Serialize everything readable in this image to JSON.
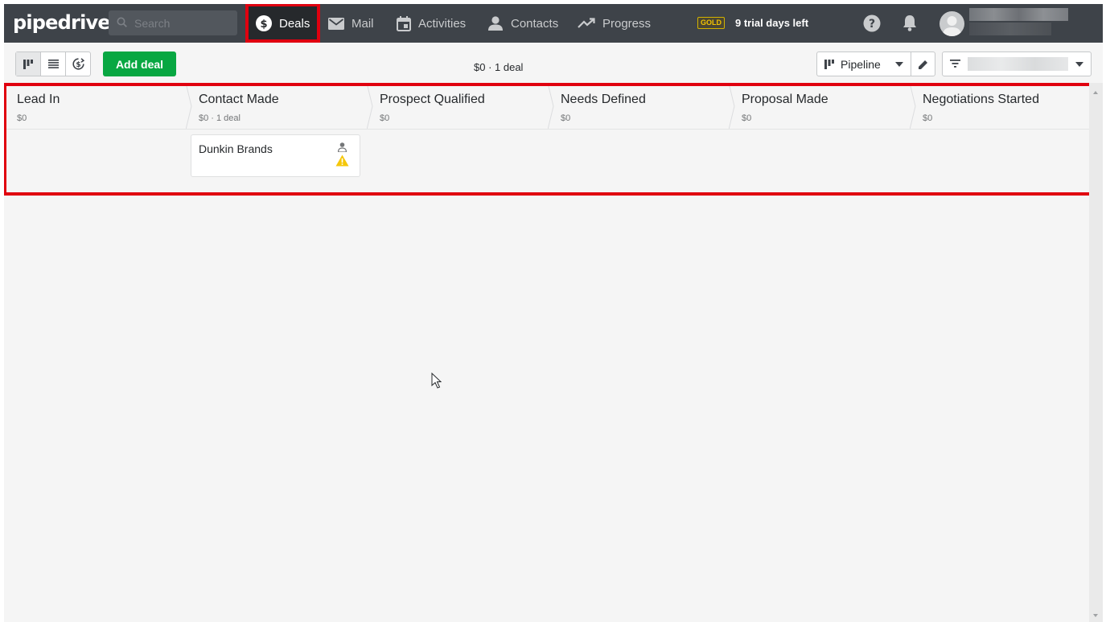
{
  "app": {
    "logo": "pipedrive"
  },
  "search": {
    "placeholder": "Search"
  },
  "nav": {
    "deals": "Deals",
    "mail": "Mail",
    "activities": "Activities",
    "contacts": "Contacts",
    "progress": "Progress"
  },
  "plan": {
    "badge": "GOLD",
    "trial": "9 trial days left"
  },
  "toolbar": {
    "add_deal": "Add deal",
    "summary": "$0 · 1 deal",
    "pipeline": "Pipeline"
  },
  "stages": [
    {
      "title": "Lead In",
      "sub": "$0"
    },
    {
      "title": "Contact Made",
      "sub": "$0 · 1 deal"
    },
    {
      "title": "Prospect Qualified",
      "sub": "$0"
    },
    {
      "title": "Needs Defined",
      "sub": "$0"
    },
    {
      "title": "Proposal Made",
      "sub": "$0"
    },
    {
      "title": "Negotiations Started",
      "sub": "$0"
    }
  ],
  "deals": [
    {
      "name": "Dunkin Brands",
      "stage": "Contact Made"
    }
  ],
  "colors": {
    "topbar": "#3e4349",
    "active_nav": "#26292c",
    "add_deal": "#08a742",
    "highlight": "#e0000f",
    "warning": "#f5c70a"
  }
}
